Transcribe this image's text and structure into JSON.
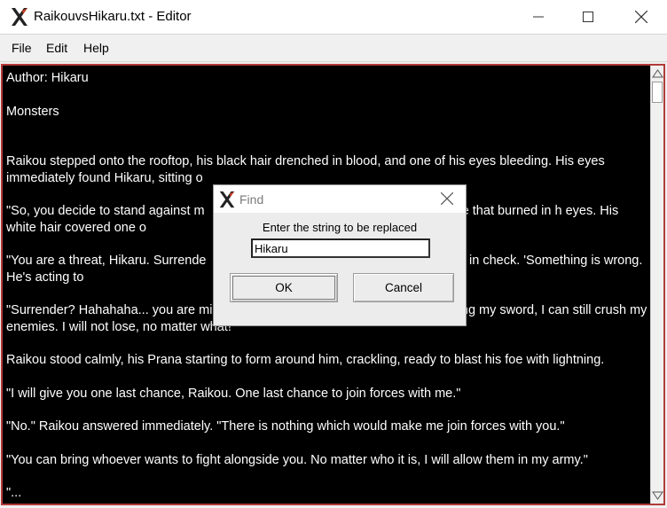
{
  "window": {
    "title": "RaikouvsHikaru.txt - Editor"
  },
  "menu": {
    "items": [
      "File",
      "Edit",
      "Help"
    ]
  },
  "editor": {
    "paragraphs": [
      "Author: Hikaru",
      "Monsters",
      "",
      "Raikou stepped onto the rooftop, his black hair drenched in blood, and one of his eyes bleeding. His eyes immediately found Hikaru, sitting o",
      "\"So, you decide to stand against m                                                  hint of the rage that burned in h eyes. His white hair covered one o                                                     ind.",
      "\"You are a threat, Hikaru. Surrende                                                  eping his rage in check. 'Something is wrong. He's acting to",
      "\"Surrender? Hahahaha... you are mistaken, Raikou. I am still alive. I can still swing my sword, I can still crush my enemies. I will not lose, no matter what!\"",
      "Raikou stood calmly, his Prana starting to form around him, crackling, ready to blast his foe with lightning.",
      "\"I will give you one last chance, Raikou. One last chance to join forces with me.\"",
      "\"No.\" Raikou answered immediately. \"There is nothing which would make me join forces with you.\"",
      "\"You can bring whoever wants to fight alongside you. No matter who it is, I will allow them in my army.\"",
      "\"..."
    ]
  },
  "dialog": {
    "title": "Find",
    "prompt": "Enter the string to be replaced",
    "input_value": "Hikaru",
    "ok_label": "OK",
    "cancel_label": "Cancel"
  },
  "icons": {
    "app": "app-x-icon",
    "minimize": "minimize-icon",
    "maximize": "maximize-icon",
    "close": "close-icon",
    "scroll_up": "scroll-up-arrow-icon",
    "scroll_down": "scroll-down-arrow-icon"
  },
  "colors": {
    "editor_bg": "#000000",
    "editor_text": "#ffffff",
    "editor_border": "#b23a3a"
  }
}
